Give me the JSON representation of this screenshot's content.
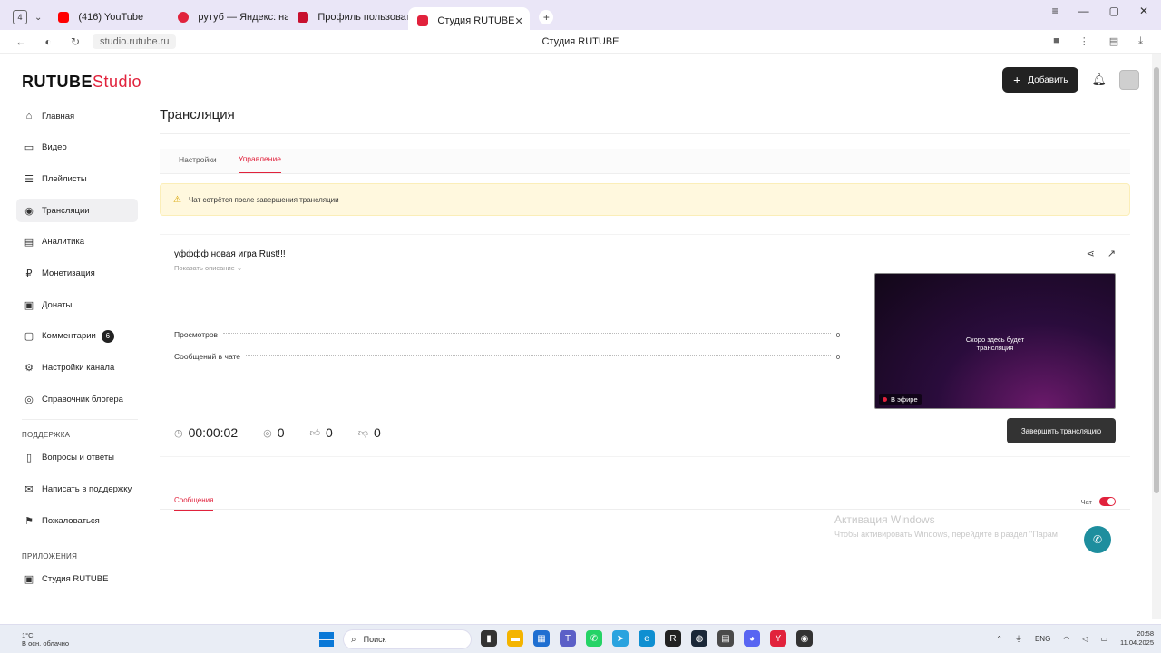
{
  "browser": {
    "tab_count": "4",
    "tabs": [
      {
        "label": "(416) YouTube",
        "color": "#ff0000"
      },
      {
        "label": "рутуб — Яндекс: нашлось",
        "color": "#e1223c"
      },
      {
        "label": "Профиль пользователя #",
        "color": "#c8102e"
      },
      {
        "label": "Студия RUTUBE",
        "color": "#e1223c"
      }
    ],
    "url": "studio.rutube.ru",
    "page_title": "Студия RUTUBE"
  },
  "logo": {
    "brand": "RUTUBE",
    "product": "Studio"
  },
  "header": {
    "add_label": "Добавить"
  },
  "sidebar": {
    "items": [
      {
        "label": "Главная",
        "icon": "⌂"
      },
      {
        "label": "Видео",
        "icon": "▭"
      },
      {
        "label": "Плейлисты",
        "icon": "☰"
      },
      {
        "label": "Трансляции",
        "icon": "◉"
      },
      {
        "label": "Аналитика",
        "icon": "▤"
      },
      {
        "label": "Монетизация",
        "icon": "₽"
      },
      {
        "label": "Донаты",
        "icon": "▣"
      },
      {
        "label": "Комментарии",
        "icon": "▢",
        "badge": "6"
      },
      {
        "label": "Настройки канала",
        "icon": "⚙"
      },
      {
        "label": "Справочник блогера",
        "icon": "◎"
      }
    ],
    "support_title": "ПОДДЕРЖКА",
    "support_items": [
      {
        "label": "Вопросы и ответы",
        "icon": "▯"
      },
      {
        "label": "Написать в поддержку",
        "icon": "✉"
      },
      {
        "label": "Пожаловаться",
        "icon": "⚑"
      }
    ],
    "apps_title": "ПРИЛОЖЕНИЯ",
    "apps_items": [
      {
        "label": "Студия RUTUBE",
        "icon": "▣"
      }
    ]
  },
  "main": {
    "title": "Трансляция",
    "tabs": [
      "Настройки",
      "Управление"
    ],
    "warning": "Чат сотрётся после завершения трансляции",
    "stream_title": "уфффф новая игра Rust!!!",
    "show_description": "Показать описание ⌄",
    "stats": [
      {
        "label": "Просмотров",
        "value": "0"
      },
      {
        "label": "Сообщений в чате",
        "value": "0"
      }
    ],
    "preview_text_line1": "Скоро здесь будет",
    "preview_text_line2": "трансляция",
    "live_label": "В эфире",
    "metrics": {
      "duration": "00:00:02",
      "viewers": "0",
      "likes": "0",
      "dislikes": "0"
    },
    "end_button": "Завершить трансляцию",
    "messages_tab": "Сообщения",
    "chat_label": "Чат"
  },
  "watermark": {
    "line1": "Активация Windows",
    "line2": "Чтобы активировать Windows, перейдите в раздел \"Парам"
  },
  "taskbar": {
    "weather_temp": "1°C",
    "weather_desc": "В осн. облачно",
    "search_placeholder": "Поиск",
    "lang": "ENG",
    "time": "20:58",
    "date": "11.04.2025"
  }
}
